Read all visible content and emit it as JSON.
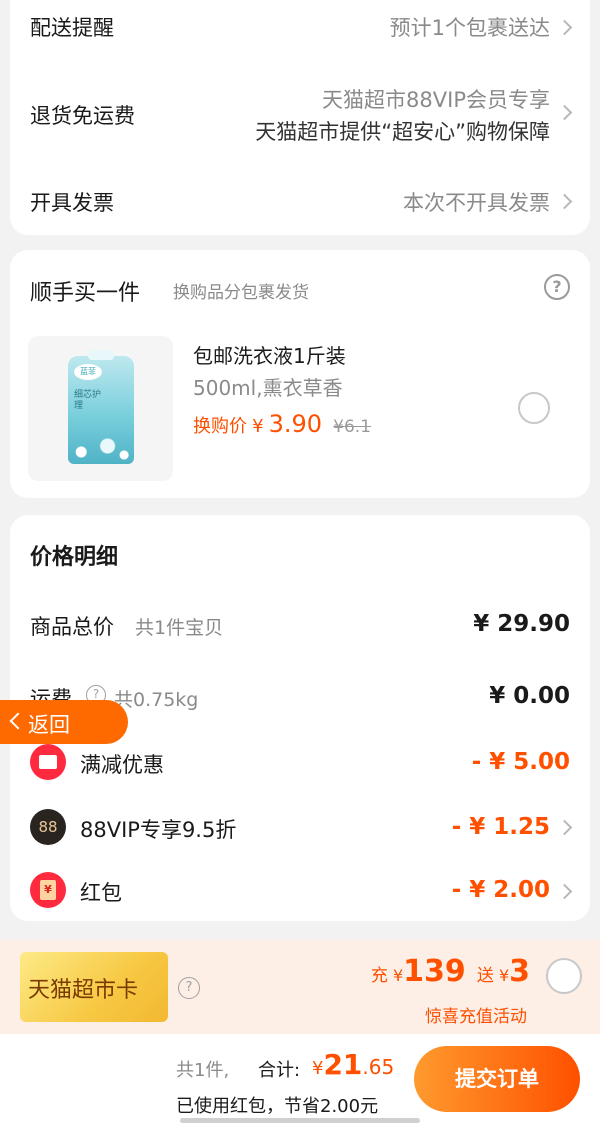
{
  "delivery": {
    "reminder_label": "配送提醒",
    "reminder_value": "预计1个包裹送达",
    "return_label": "退货免运费",
    "return_value_1": "天猫超市88VIP会员专享",
    "return_value_2": "天猫超市提供“超安心”购物保障",
    "invoice_label": "开具发票",
    "invoice_value": "本次不开具发票"
  },
  "addon": {
    "title": "顺手买一件",
    "subtitle": "换购品分包裹发货",
    "help_icon": "question-circle-icon",
    "product_name": "包邮洗衣液1斤装",
    "product_spec": "500ml,熏衣草香",
    "price_prefix": "换购价",
    "currency": "¥",
    "price": "3.90",
    "original_price": "¥6.1",
    "product_image_brand": "蓝菲",
    "product_image_text": "细芯护理"
  },
  "price_detail": {
    "title": "价格明细",
    "items_label": "商品总价",
    "items_count": "共1件宝贝",
    "items_total": "¥ 29.90",
    "shipping_label": "运费",
    "shipping_weight": "共0.75kg",
    "shipping_value": "¥ 0.00",
    "back_button": "返回",
    "promo_label": "满减优惠",
    "promo_value": "- ¥ 5.00",
    "vip_badge": "88",
    "vip_label": "88VIP专享9.5折",
    "vip_value": "- ¥ 1.25",
    "redpacket_label": "红包",
    "redpacket_value": "- ¥ 2.00",
    "redpacket_icon_char": "¥"
  },
  "supercard": {
    "card_label": "天猫超市卡",
    "charge_prefix": "充",
    "charge_currency": "¥",
    "charge_amount": "139",
    "gift_prefix": "送",
    "gift_currency": "¥",
    "gift_amount": "3",
    "activity": "惊喜充值活动"
  },
  "footer": {
    "count": "共1件,",
    "total_label": "合计:",
    "total_currency": "¥",
    "total_int": "21",
    "total_dec": ".65",
    "saving_text": "已使用红包，节省2.00元",
    "submit_button": "提交订单"
  },
  "colors": {
    "accent": "#ff5000",
    "background": "#f2f2f2",
    "card": "#ffffff",
    "gold": "#f7c843"
  }
}
